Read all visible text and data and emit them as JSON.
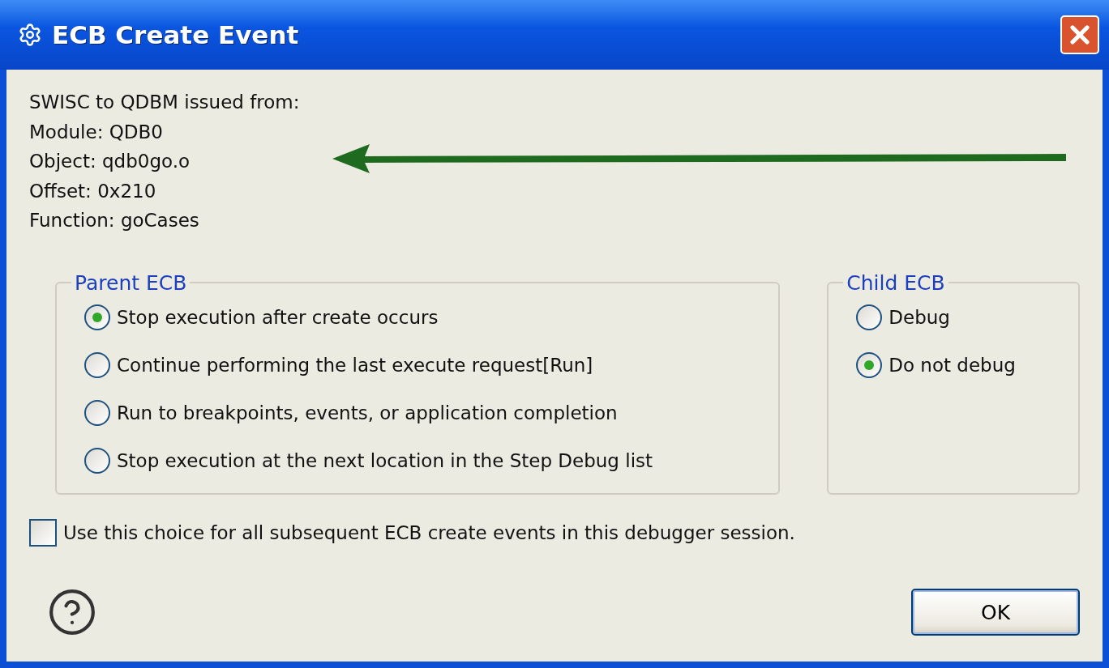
{
  "window": {
    "title": "ECB Create Event"
  },
  "info_lines": [
    "SWISC to QDBM issued from:",
    "Module: QDB0",
    "Object: qdb0go.o",
    "Offset: 0x210",
    "Function: goCases"
  ],
  "parent_ecb": {
    "title": "Parent ECB",
    "options": [
      {
        "label": "Stop execution after create occurs",
        "selected": true
      },
      {
        "label": "Continue performing the last execute request[Run]",
        "selected": false
      },
      {
        "label": "Run to breakpoints, events, or application completion",
        "selected": false
      },
      {
        "label": "Stop execution at the next location in the Step Debug list",
        "selected": false
      }
    ]
  },
  "child_ecb": {
    "title": "Child ECB",
    "options": [
      {
        "label": "Debug",
        "selected": false
      },
      {
        "label": "Do not debug",
        "selected": true
      }
    ]
  },
  "remember_choice": {
    "label": "Use this choice for all subsequent ECB create events in this debugger session.",
    "checked": false
  },
  "buttons": [
    {
      "label": "OK"
    }
  ]
}
